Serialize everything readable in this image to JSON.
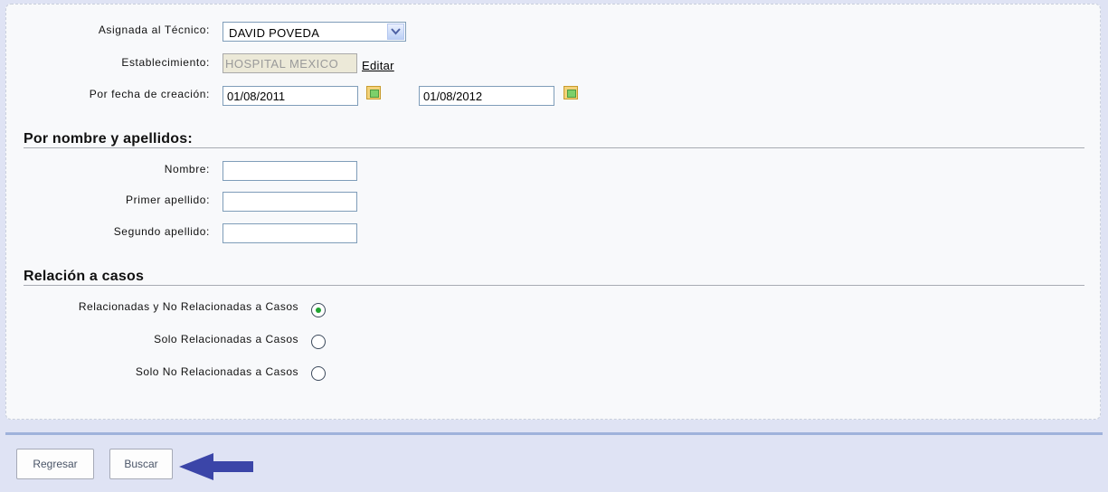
{
  "filters": {
    "tecnico_label": "Asignada al Técnico:",
    "tecnico_value": "DAVID POVEDA",
    "establecimiento_label": "Establecimiento:",
    "establecimiento_value": "HOSPITAL MEXICO",
    "editar_link": "Editar",
    "fecha_label": "Por fecha de creación:",
    "fecha_desde": "01/08/2011",
    "fecha_hasta": "01/08/2012"
  },
  "nombre_section": {
    "title": "Por nombre y apellidos:",
    "nombre_label": "Nombre:",
    "nombre_value": "",
    "primer_label": "Primer apellido:",
    "primer_value": "",
    "segundo_label": "Segundo apellido:",
    "segundo_value": ""
  },
  "relacion_section": {
    "title": "Relación a casos",
    "options": [
      {
        "label": "Relacionadas y No Relacionadas a Casos",
        "checked": true
      },
      {
        "label": "Solo Relacionadas a Casos",
        "checked": false
      },
      {
        "label": "Solo No Relacionadas a Casos",
        "checked": false
      }
    ]
  },
  "actions": {
    "regresar_label": "Regresar",
    "buscar_label": "Buscar"
  },
  "colors": {
    "page_background": "#dfe3f4",
    "panel_background": "#f8f9fb",
    "radio_selected": "#1fa330",
    "arrow": "#3b45a8"
  },
  "icons": {
    "calendar": "calendar-icon",
    "dropdown": "chevron-down-icon",
    "pointer": "arrow-left-icon"
  }
}
